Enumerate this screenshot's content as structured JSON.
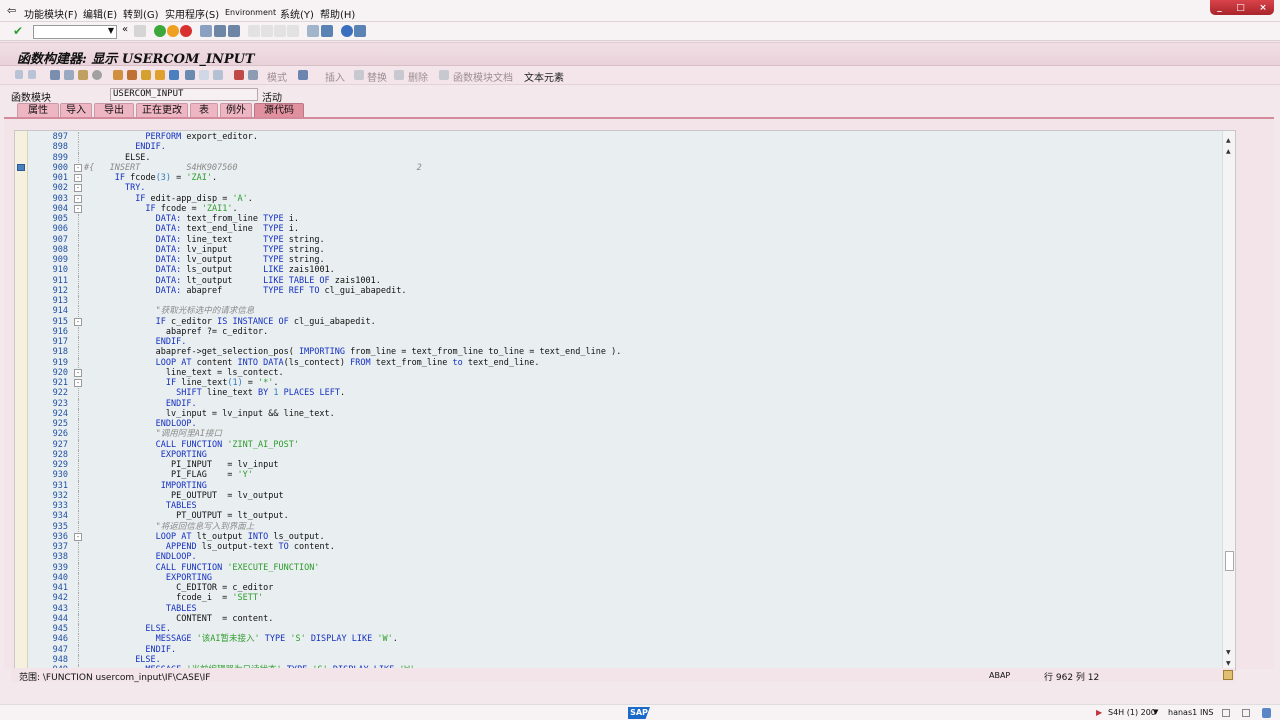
{
  "menu": {
    "items": [
      "功能模块(F)",
      "编辑(E)",
      "转到(G)",
      "实用程序(S)",
      "Environment",
      "系统(Y)",
      "帮助(H)"
    ]
  },
  "window_controls": [
    "_",
    "□",
    "×"
  ],
  "command_field": {
    "value": "",
    "history_icon": "«"
  },
  "title": "函数构建器: 显示 USERCOM_INPUT",
  "app_toolbar": {
    "labels": [
      {
        "text": "模式",
        "enabled": false
      },
      {
        "text": "插入",
        "enabled": false
      },
      {
        "text": "替换",
        "enabled": false
      },
      {
        "text": "删除",
        "enabled": false
      },
      {
        "text": "函数模块文档",
        "enabled": false
      },
      {
        "text": "文本元素",
        "enabled": true
      }
    ]
  },
  "function_module": {
    "label": "函数模块",
    "value": "USERCOM_INPUT",
    "status": "活动"
  },
  "tabs": [
    "属性",
    "导入",
    "导出",
    "正在更改",
    "表",
    "例外",
    "源代码"
  ],
  "active_tab": "源代码",
  "code": {
    "first_line": 897,
    "lines": [
      [
        [
          "            ",
          "t"
        ],
        [
          "PERFORM",
          "k"
        ],
        [
          " export_editor.",
          "t"
        ]
      ],
      [
        [
          "          ",
          "t"
        ],
        [
          "ENDIF.",
          "k"
        ]
      ],
      [
        [
          "        ",
          "t"
        ],
        [
          "ELSE.",
          "t"
        ]
      ],
      [
        [
          "#{   INSERT         S4HK907560                                   2",
          "c"
        ]
      ],
      [
        [
          "      ",
          "t"
        ],
        [
          "IF",
          "k"
        ],
        [
          " fcode",
          "t"
        ],
        [
          "(3)",
          "n"
        ],
        [
          " = ",
          "t"
        ],
        [
          "'ZAI'",
          "s"
        ],
        [
          ".",
          "t"
        ]
      ],
      [
        [
          "        ",
          "t"
        ],
        [
          "TRY.",
          "k"
        ]
      ],
      [
        [
          "          ",
          "t"
        ],
        [
          "IF",
          "k"
        ],
        [
          " edit-app_disp = ",
          "t"
        ],
        [
          "'A'",
          "s"
        ],
        [
          ".",
          "t"
        ]
      ],
      [
        [
          "            ",
          "t"
        ],
        [
          "IF",
          "k"
        ],
        [
          " fcode = ",
          "t"
        ],
        [
          "'ZAI1'",
          "s"
        ],
        [
          ".",
          "t"
        ]
      ],
      [
        [
          "              ",
          "t"
        ],
        [
          "DATA:",
          "k"
        ],
        [
          " text_from_line ",
          "t"
        ],
        [
          "TYPE",
          "k"
        ],
        [
          " i.",
          "t"
        ]
      ],
      [
        [
          "              ",
          "t"
        ],
        [
          "DATA:",
          "k"
        ],
        [
          " text_end_line  ",
          "t"
        ],
        [
          "TYPE",
          "k"
        ],
        [
          " i.",
          "t"
        ]
      ],
      [
        [
          "              ",
          "t"
        ],
        [
          "DATA:",
          "k"
        ],
        [
          " line_text      ",
          "t"
        ],
        [
          "TYPE",
          "k"
        ],
        [
          " string.",
          "t"
        ]
      ],
      [
        [
          "              ",
          "t"
        ],
        [
          "DATA:",
          "k"
        ],
        [
          " lv_input       ",
          "t"
        ],
        [
          "TYPE",
          "k"
        ],
        [
          " string.",
          "t"
        ]
      ],
      [
        [
          "              ",
          "t"
        ],
        [
          "DATA:",
          "k"
        ],
        [
          " lv_output      ",
          "t"
        ],
        [
          "TYPE",
          "k"
        ],
        [
          " string.",
          "t"
        ]
      ],
      [
        [
          "              ",
          "t"
        ],
        [
          "DATA:",
          "k"
        ],
        [
          " ls_output      ",
          "t"
        ],
        [
          "LIKE",
          "k"
        ],
        [
          " zais1001.",
          "t"
        ]
      ],
      [
        [
          "              ",
          "t"
        ],
        [
          "DATA:",
          "k"
        ],
        [
          " lt_output      ",
          "t"
        ],
        [
          "LIKE TABLE OF",
          "k"
        ],
        [
          " zais1001.",
          "t"
        ]
      ],
      [
        [
          "              ",
          "t"
        ],
        [
          "DATA:",
          "k"
        ],
        [
          " abapref        ",
          "t"
        ],
        [
          "TYPE REF TO",
          "k"
        ],
        [
          " cl_gui_abapedit.",
          "t"
        ]
      ],
      [
        [
          "",
          "t"
        ]
      ],
      [
        [
          "              ",
          "t"
        ],
        [
          "\"获取光标选中的请求信息",
          "c"
        ]
      ],
      [
        [
          "              ",
          "t"
        ],
        [
          "IF",
          "k"
        ],
        [
          " c_editor ",
          "t"
        ],
        [
          "IS INSTANCE OF",
          "k"
        ],
        [
          " cl_gui_abapedit.",
          "t"
        ]
      ],
      [
        [
          "                abapref ?= c_editor.",
          "t"
        ]
      ],
      [
        [
          "              ",
          "t"
        ],
        [
          "ENDIF.",
          "k"
        ]
      ],
      [
        [
          "              abapref->get_selection_pos( ",
          "t"
        ],
        [
          "IMPORTING",
          "k"
        ],
        [
          " from_line = text_from_line to_line = text_end_line ).",
          "t"
        ]
      ],
      [
        [
          "              ",
          "t"
        ],
        [
          "LOOP AT",
          "k"
        ],
        [
          " content ",
          "t"
        ],
        [
          "INTO DATA",
          "k"
        ],
        [
          "(ls_contect) ",
          "t"
        ],
        [
          "FROM",
          "k"
        ],
        [
          " text_from_line ",
          "t"
        ],
        [
          "to",
          "k"
        ],
        [
          " text_end_line.",
          "t"
        ]
      ],
      [
        [
          "                line_text = ls_contect.",
          "t"
        ]
      ],
      [
        [
          "                ",
          "t"
        ],
        [
          "IF",
          "k"
        ],
        [
          " line_text",
          "t"
        ],
        [
          "(1)",
          "n"
        ],
        [
          " = ",
          "t"
        ],
        [
          "'*'",
          "s"
        ],
        [
          ".",
          "t"
        ]
      ],
      [
        [
          "                  ",
          "t"
        ],
        [
          "SHIFT",
          "k"
        ],
        [
          " line_text ",
          "t"
        ],
        [
          "BY",
          "k"
        ],
        [
          " ",
          "t"
        ],
        [
          "1",
          "n"
        ],
        [
          " ",
          "t"
        ],
        [
          "PLACES LEFT",
          "k"
        ],
        [
          ".",
          "t"
        ]
      ],
      [
        [
          "                ",
          "t"
        ],
        [
          "ENDIF.",
          "k"
        ]
      ],
      [
        [
          "                lv_input = lv_input && line_text.",
          "t"
        ]
      ],
      [
        [
          "              ",
          "t"
        ],
        [
          "ENDLOOP.",
          "k"
        ]
      ],
      [
        [
          "              ",
          "t"
        ],
        [
          "\"调用阿里AI接口",
          "c"
        ]
      ],
      [
        [
          "              ",
          "t"
        ],
        [
          "CALL FUNCTION",
          "k"
        ],
        [
          " ",
          "t"
        ],
        [
          "'ZINT_AI_POST'",
          "s"
        ]
      ],
      [
        [
          "               ",
          "t"
        ],
        [
          "EXPORTING",
          "k"
        ]
      ],
      [
        [
          "                 PI_INPUT   = lv_input",
          "t"
        ]
      ],
      [
        [
          "                 PI_FLAG    = ",
          "t"
        ],
        [
          "'Y'",
          "s"
        ]
      ],
      [
        [
          "               ",
          "t"
        ],
        [
          "IMPORTING",
          "k"
        ]
      ],
      [
        [
          "                 PE_OUTPUT  = lv_output",
          "t"
        ]
      ],
      [
        [
          "                ",
          "t"
        ],
        [
          "TABLES",
          "k"
        ]
      ],
      [
        [
          "                  PT_OUTPUT = lt_output.",
          "t"
        ]
      ],
      [
        [
          "              ",
          "t"
        ],
        [
          "\"将返回信息写入到界面上",
          "c"
        ]
      ],
      [
        [
          "              ",
          "t"
        ],
        [
          "LOOP AT",
          "k"
        ],
        [
          " lt_output ",
          "t"
        ],
        [
          "INTO",
          "k"
        ],
        [
          " ls_output.",
          "t"
        ]
      ],
      [
        [
          "                ",
          "t"
        ],
        [
          "APPEND",
          "k"
        ],
        [
          " ls_output-text ",
          "t"
        ],
        [
          "TO",
          "k"
        ],
        [
          " content.",
          "t"
        ]
      ],
      [
        [
          "              ",
          "t"
        ],
        [
          "ENDLOOP.",
          "k"
        ]
      ],
      [
        [
          "              ",
          "t"
        ],
        [
          "CALL FUNCTION",
          "k"
        ],
        [
          " ",
          "t"
        ],
        [
          "'EXECUTE_FUNCTION'",
          "s"
        ]
      ],
      [
        [
          "                ",
          "t"
        ],
        [
          "EXPORTING",
          "k"
        ]
      ],
      [
        [
          "                  C_EDITOR = c_editor",
          "t"
        ]
      ],
      [
        [
          "                  fcode_i  = ",
          "t"
        ],
        [
          "'SETT'",
          "s"
        ]
      ],
      [
        [
          "                ",
          "t"
        ],
        [
          "TABLES",
          "k"
        ]
      ],
      [
        [
          "                  CONTENT  = content.",
          "t"
        ]
      ],
      [
        [
          "            ",
          "t"
        ],
        [
          "ELSE.",
          "k"
        ]
      ],
      [
        [
          "              ",
          "t"
        ],
        [
          "MESSAGE",
          "k"
        ],
        [
          " ",
          "t"
        ],
        [
          "'该AI暂未接入'",
          "s"
        ],
        [
          " ",
          "t"
        ],
        [
          "TYPE",
          "k"
        ],
        [
          " ",
          "t"
        ],
        [
          "'S'",
          "s"
        ],
        [
          " ",
          "t"
        ],
        [
          "DISPLAY LIKE",
          "k"
        ],
        [
          " ",
          "t"
        ],
        [
          "'W'",
          "s"
        ],
        [
          ".",
          "t"
        ]
      ],
      [
        [
          "            ",
          "t"
        ],
        [
          "ENDIF.",
          "k"
        ]
      ],
      [
        [
          "          ",
          "t"
        ],
        [
          "ELSE.",
          "k"
        ]
      ],
      [
        [
          "            ",
          "t"
        ],
        [
          "MESSAGE",
          "k"
        ],
        [
          " ",
          "t"
        ],
        [
          "'当前编辑器为只读状态'",
          "s"
        ],
        [
          " ",
          "t"
        ],
        [
          "TYPE",
          "k"
        ],
        [
          " ",
          "t"
        ],
        [
          "'S'",
          "s"
        ],
        [
          " ",
          "t"
        ],
        [
          "DISPLAY LIKE",
          "k"
        ],
        [
          " ",
          "t"
        ],
        [
          "'W'",
          "s"
        ]
      ]
    ]
  },
  "status": {
    "scope": "范围: \\FUNCTION usercom_input\\IF\\CASE\\IF",
    "language": "ABAP",
    "position": "行 962 列 12"
  },
  "bottom": {
    "system": "S4H (1) 200",
    "user": "hanas1",
    "mode": "INS",
    "logo": "SAP"
  },
  "colors": {
    "menu_bg": "#f7f3f4",
    "title_bg": "#ebd5dc",
    "tab_bg": "#eeb5c2",
    "tab_active": "#e0909f",
    "editor_bg": "#e9eff0",
    "keyword": "#1530c0",
    "string": "#2e9b2e",
    "comment": "#8a8a8a",
    "line_number": "#1f4fa3",
    "close_red": "#c2343b"
  }
}
